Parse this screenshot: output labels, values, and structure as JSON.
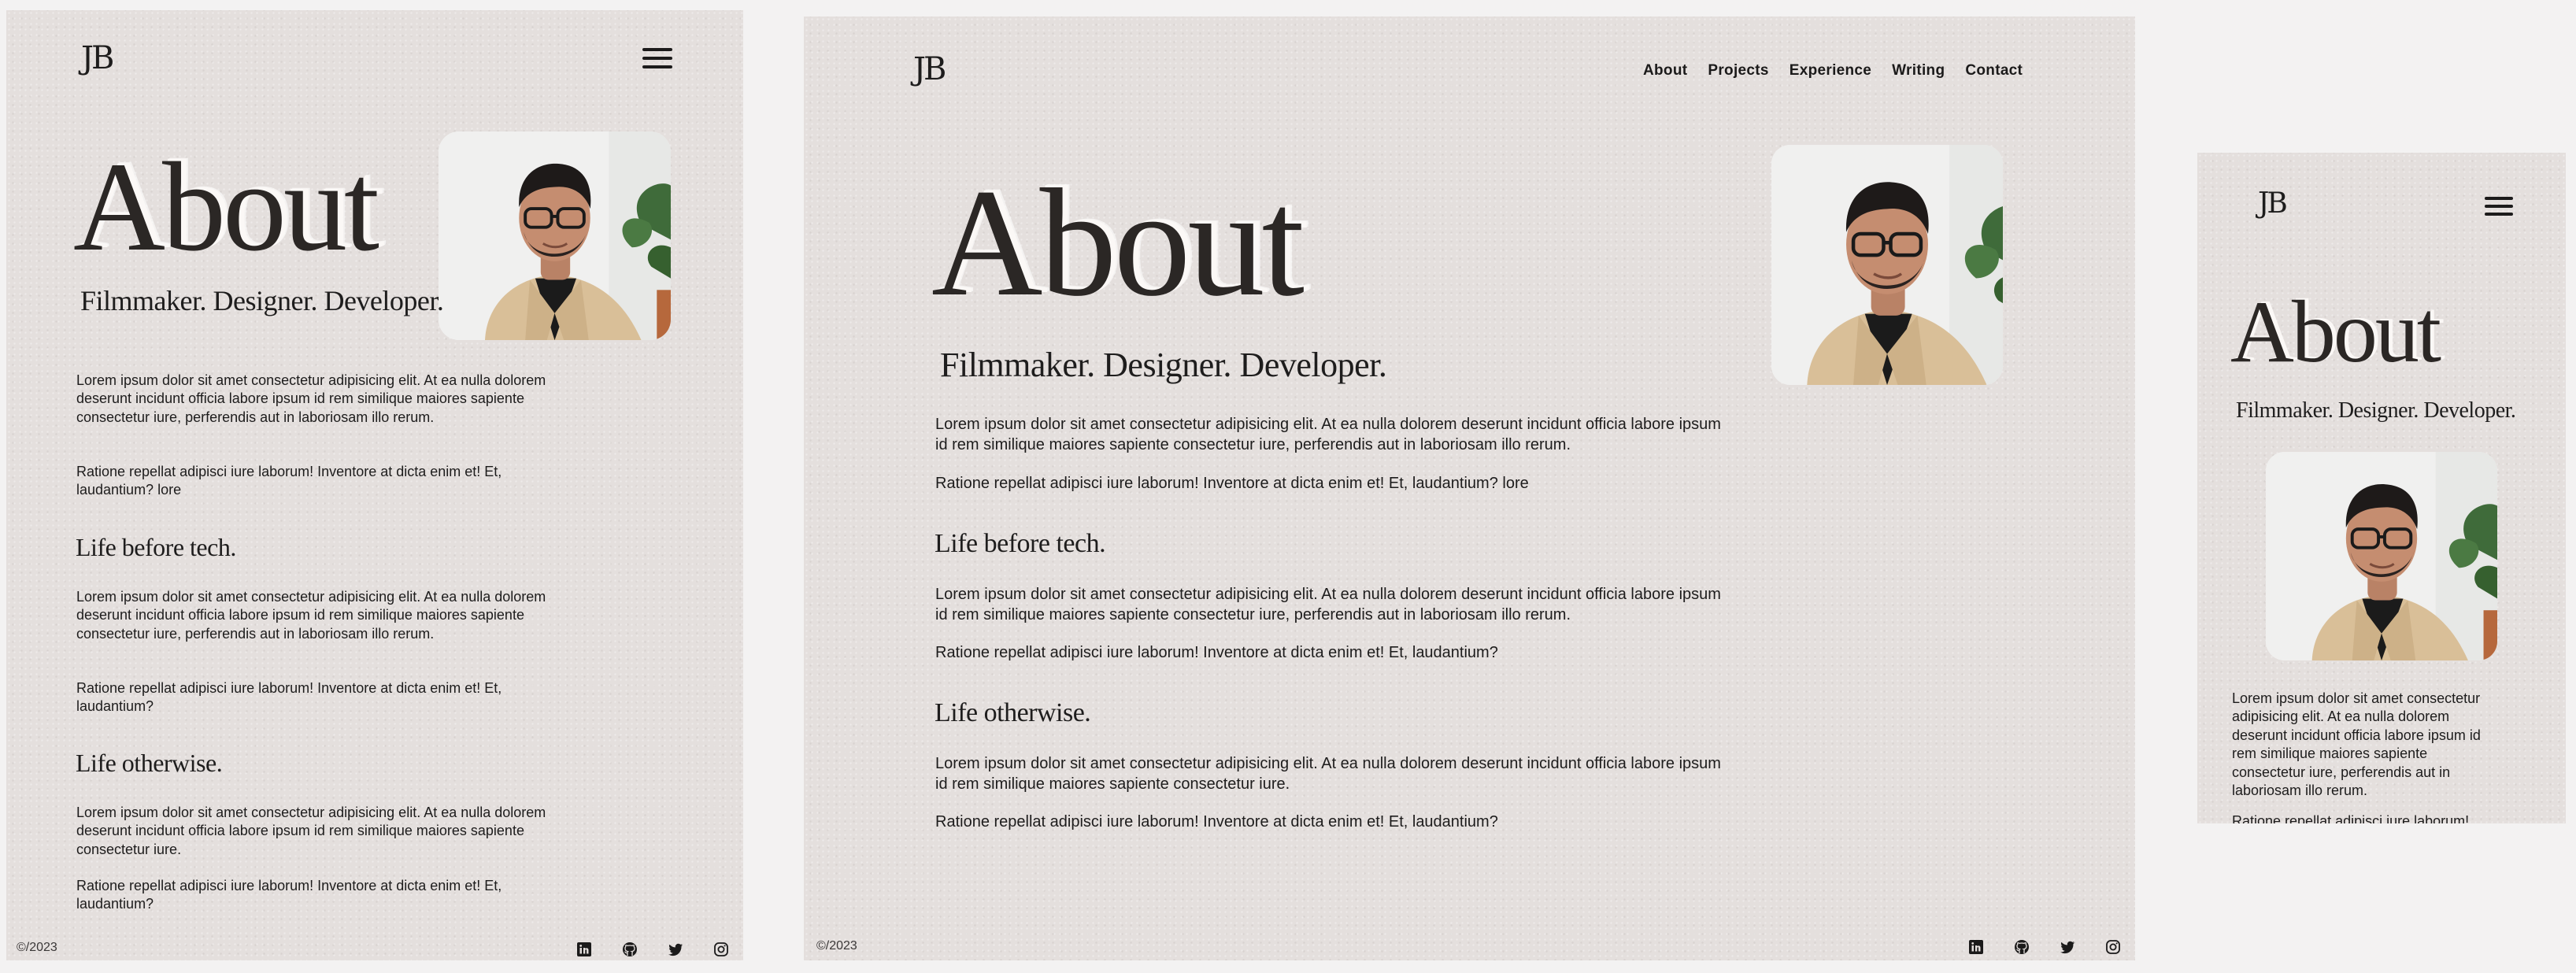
{
  "brand": {
    "logo": "JB"
  },
  "nav": {
    "items": [
      "About",
      "Projects",
      "Experience",
      "Writing",
      "Contact"
    ]
  },
  "hero": {
    "title": "About",
    "subtitle": "Filmmaker. Designer. Developer."
  },
  "intro": {
    "p1": "Lorem ipsum dolor sit amet consectetur adipisicing elit. At ea nulla dolorem deserunt incidunt officia labore ipsum id rem similique maiores sapiente consectetur iure, perferendis aut in laboriosam illo rerum.",
    "p2": "Ratione repellat adipisci iure laborum! Inventore at dicta enim et! Et, laudantium? lore"
  },
  "sections": [
    {
      "heading": "Life before tech.",
      "p1": "Lorem ipsum dolor sit amet consectetur adipisicing elit. At ea nulla dolorem deserunt incidunt officia labore ipsum id rem similique maiores sapiente consectetur iure, perferendis aut in laboriosam illo rerum.",
      "p2": "Ratione repellat adipisci iure laborum! Inventore at dicta enim et! Et, laudantium?"
    },
    {
      "heading": "Life otherwise.",
      "p1": "Lorem ipsum dolor sit amet consectetur adipisicing elit. At ea nulla dolorem deserunt incidunt officia labore ipsum id rem similique maiores sapiente consectetur iure.",
      "p2": "Ratione repellat adipisci iure laborum! Inventore at dicta enim et! Et, laudantium?"
    }
  ],
  "mobile": {
    "cut_line": "Ratione repellat adipisci iure laborum!"
  },
  "footer": {
    "copyright": "©/2023",
    "socials": [
      "linkedin-icon",
      "github-icon",
      "twitter-icon",
      "instagram-icon"
    ]
  },
  "colors": {
    "page": "#e4dfdd",
    "ink": "#1d1c1c",
    "title": "#2b2725"
  }
}
